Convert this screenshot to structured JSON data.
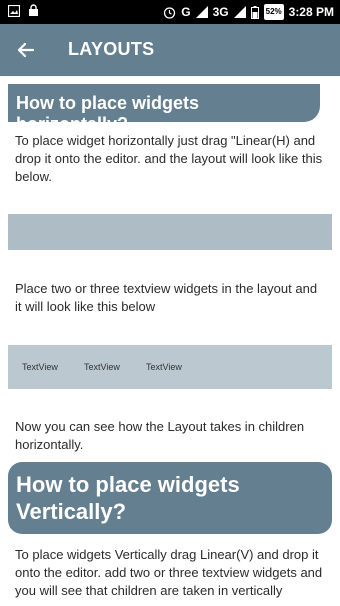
{
  "status": {
    "time": "3:28 PM",
    "battery": "52%",
    "network": "3G",
    "signal_label": "G"
  },
  "appbar": {
    "title": "LAYOUTS",
    "back_icon": "arrow-left-icon"
  },
  "sections": [
    {
      "heading": "How to place widgets horizontally?",
      "paragraph": "To place widget horizontally just drag \"Linear(H) and drop it onto the editor. and the layout will look like this below.",
      "paragraph2": "Place two or three textview widgets in the layout and it will look like this below",
      "textviews": [
        "TextView",
        "TextView",
        "TextView"
      ],
      "paragraph3": "Now you can see how the Layout takes in children horizontally."
    },
    {
      "heading": "How to place widgets Vertically?",
      "paragraph": "To place widgets Vertically drag Linear(V) and drop it onto the editor. add two or three textview widgets and you will see that children are taken in vertically"
    }
  ],
  "colors": {
    "accent": "#647f8f",
    "band": "#aebcc6",
    "status_bar": "#000000"
  }
}
